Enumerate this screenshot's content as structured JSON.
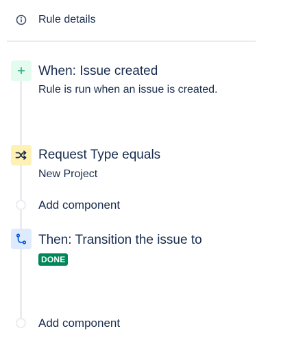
{
  "header": {
    "rule_details_label": "Rule details",
    "icon": "info-icon"
  },
  "trigger": {
    "title": "When: Issue created",
    "description": "Rule is run when an issue is created.",
    "icon": "plus-icon",
    "color": "#36b37e"
  },
  "condition": {
    "title": "Request Type equals",
    "value": "New Project",
    "icon": "shuffle-icon",
    "color": "#172b4d"
  },
  "action": {
    "title": "Then: Transition the issue to",
    "status_badge": "DONE",
    "status_color": "#00875a",
    "icon": "transition-icon",
    "color": "#0052cc"
  },
  "add_component": [
    {
      "label": "Add component"
    },
    {
      "label": "Add component"
    }
  ]
}
